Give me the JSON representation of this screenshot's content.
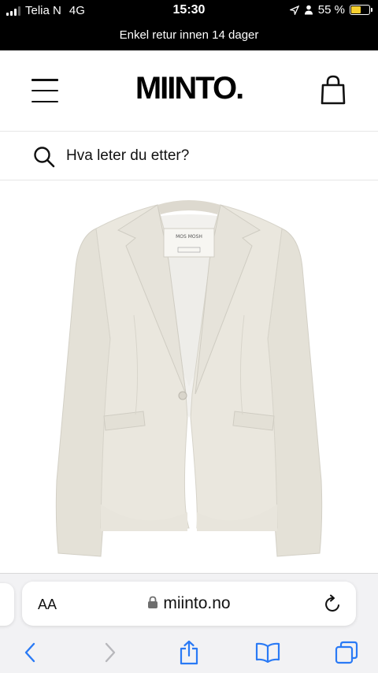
{
  "status_bar": {
    "carrier": "Telia N",
    "network": "4G",
    "time": "15:30",
    "battery_percent": "55 %",
    "battery_level": 0.55,
    "battery_color": "#f7cf2e"
  },
  "announcement": {
    "text": "Enkel retur innen 14 dager"
  },
  "header": {
    "logo": "MIINTO."
  },
  "search": {
    "placeholder": "Hva leter du etter?"
  },
  "product": {
    "image_icon": "blazer-image",
    "label_text": "MOS MOSH"
  },
  "browser": {
    "text_size_label": "AA",
    "url": "miinto.no"
  },
  "colors": {
    "accent": "#2a7af5",
    "text": "#111111",
    "blazer": "#e9e6dd"
  }
}
